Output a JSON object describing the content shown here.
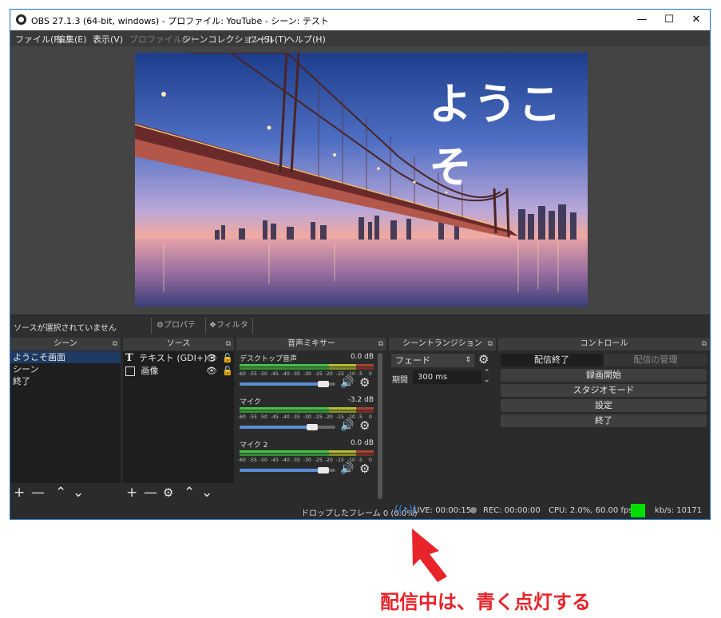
{
  "window": {
    "title": "OBS 27.1.3 (64-bit, windows) - プロファイル: YouTube - シーン: テスト",
    "min_icon": "minimize-icon",
    "max_icon": "maximize-icon",
    "close_icon": "close-icon"
  },
  "menu": [
    {
      "label": "ファイル(F)",
      "disabled": false
    },
    {
      "label": "編集(E)",
      "disabled": false
    },
    {
      "label": "表示(V)",
      "disabled": false
    },
    {
      "label": "プロファイル(P)",
      "disabled": true
    },
    {
      "label": "シーンコレクション(S)",
      "disabled": false
    },
    {
      "label": "ツール(T)",
      "disabled": false
    },
    {
      "label": "ヘルプ(H)",
      "disabled": false
    }
  ],
  "preview": {
    "overlay_text": "ようこそ"
  },
  "source_toolbar": {
    "status": "ソースが選択されていません",
    "properties": "プロパティ",
    "filters": "フィルタ"
  },
  "scenes": {
    "header": "シーン",
    "items": [
      "ようこそ画面",
      "シーン",
      "終了"
    ],
    "selected": 0
  },
  "sources": {
    "header": "ソース",
    "items": [
      {
        "label": "テキスト (GDI+) 3",
        "icon": "text-icon"
      },
      {
        "label": "画像",
        "icon": "image-icon"
      }
    ]
  },
  "mixer": {
    "header": "音声ミキサー",
    "channels": [
      {
        "name": "デスクトップ音声",
        "db": "0.0 dB",
        "level": 0.93
      },
      {
        "name": "マイク",
        "db": "-3.2 dB",
        "level": 0.82
      },
      {
        "name": "マイク 2",
        "db": "0.0 dB",
        "level": 0.93
      }
    ],
    "scale": [
      "-60",
      "-55",
      "-50",
      "-45",
      "-40",
      "-35",
      "-30",
      "-25",
      "-20",
      "-15",
      "-10",
      "-5",
      "0"
    ]
  },
  "transitions": {
    "header": "シーントランジション",
    "selected": "フェード",
    "duration_label": "期間",
    "duration_value": "300 ms"
  },
  "controls": {
    "header": "コントロール",
    "stop_stream": "配信終了",
    "manage_stream": "配信の管理",
    "start_recording": "録画開始",
    "studio_mode": "スタジオモード",
    "settings": "設定",
    "exit": "終了"
  },
  "status": {
    "dropped": "ドロップしたフレーム 0 (0.0%)",
    "live": "LIVE: 00:00:15",
    "rec": "REC: 00:00:00",
    "cpu": "CPU: 2.0%, 60.00 fps",
    "kbps": "kb/s: 10171",
    "live_color": "#3b7be0",
    "indicator_color": "#00e000"
  },
  "annotation": {
    "text": "配信中は、青く点灯する",
    "color": "#e8232a"
  }
}
